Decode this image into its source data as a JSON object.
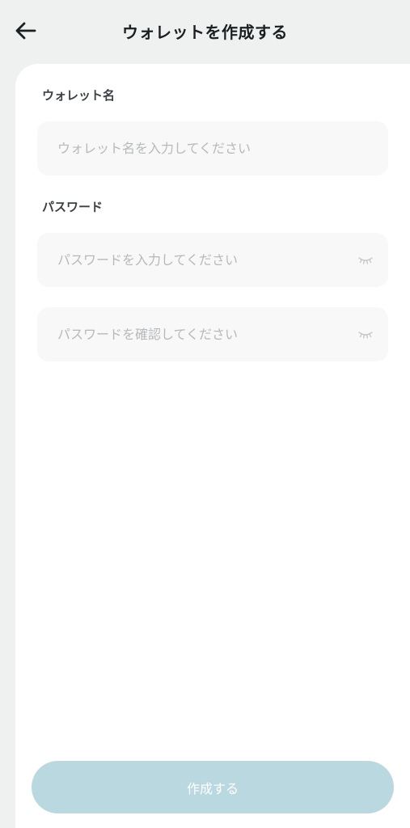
{
  "header": {
    "title": "ウォレットを作成する",
    "back_icon": "arrow-left-icon"
  },
  "form": {
    "wallet_name": {
      "label": "ウォレット名",
      "placeholder": "ウォレット名を入力してください",
      "value": ""
    },
    "password": {
      "label": "パスワード",
      "placeholder": "パスワードを入力してください",
      "value": "",
      "toggle_icon": "eye-closed-icon"
    },
    "password_confirm": {
      "placeholder": "パスワードを確認してください",
      "value": "",
      "toggle_icon": "eye-closed-icon"
    }
  },
  "submit": {
    "label": "作成する"
  },
  "colors": {
    "background": "#eef1f0",
    "card": "#ffffff",
    "field": "#f8f8f8",
    "button_disabled": "#bad8df",
    "placeholder": "#b6b9bb"
  }
}
